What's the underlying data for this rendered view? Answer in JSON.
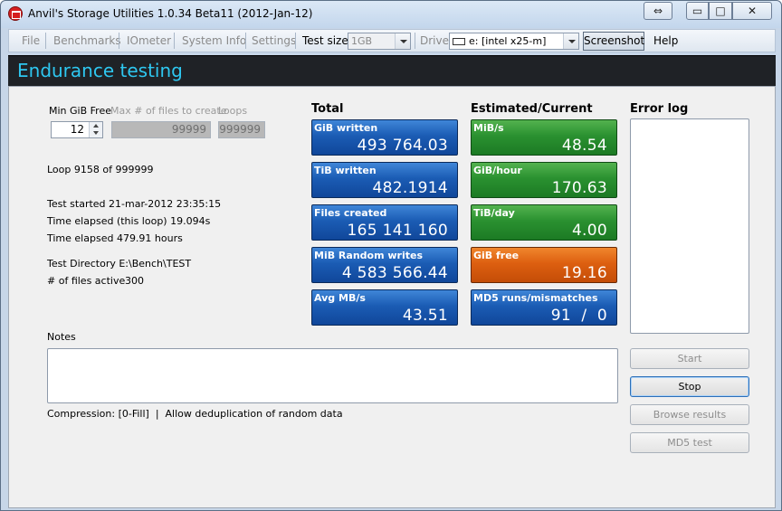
{
  "window": {
    "title": "Anvil's Storage Utilities 1.0.34 Beta11 (2012-Jan-12)",
    "resize_glyph": "⇔",
    "min_glyph": "▭",
    "max_glyph": "□",
    "close_glyph": "✕"
  },
  "menu": {
    "file": "File",
    "benchmarks": "Benchmarks",
    "iometer": "IOmeter",
    "system_info": "System Info",
    "settings": "Settings",
    "test_size_label": "Test size",
    "test_size_value": "1GB",
    "drive_label": "Drive",
    "drive_value": "e: [intel x25-m]",
    "screenshot": "Screenshot",
    "help": "Help"
  },
  "banner": {
    "title": "Endurance testing"
  },
  "params": {
    "min_gib_label": "Min GiB Free",
    "min_gib_value": "12",
    "max_files_label": "Max # of files to create",
    "max_files_value": "99999",
    "loops_label": "Loops",
    "loops_value": "999999"
  },
  "status": {
    "loop": "Loop 9158 of 999999",
    "started": "Test started 21-mar-2012 23:35:15",
    "elapsed_loop": "Time elapsed (this loop) 19.094s",
    "elapsed": "Time elapsed 479.91 hours",
    "directory": "Test Directory E:\\Bench\\TEST",
    "files_active_label": "# of files active",
    "files_active_value": "300"
  },
  "totals": {
    "heading": "Total",
    "tiles": [
      {
        "label": "GiB written",
        "value": "493 764.03"
      },
      {
        "label": "TiB written",
        "value": "482.1914"
      },
      {
        "label": "Files created",
        "value": "165 141 160"
      },
      {
        "label": "MiB Random writes",
        "value": "4 583 566.44"
      },
      {
        "label": "Avg MB/s",
        "value": "43.51"
      }
    ]
  },
  "current": {
    "heading": "Estimated/Current",
    "tiles": [
      {
        "label": "MiB/s",
        "value": "48.54"
      },
      {
        "label": "GiB/hour",
        "value": "170.63"
      },
      {
        "label": "TiB/day",
        "value": "4.00"
      },
      {
        "label": "GiB free",
        "value": "19.16"
      },
      {
        "label": "MD5 runs/mismatches",
        "value": "91  /  0"
      }
    ]
  },
  "errors": {
    "heading": "Error log"
  },
  "notes": {
    "label": "Notes",
    "compression": "Compression: [0-Fill]  |  Allow deduplication of random data"
  },
  "buttons": {
    "start": "Start",
    "stop": "Stop",
    "browse": "Browse results",
    "md5": "MD5 test"
  },
  "colors": {
    "tile_blue": "#1b5cb4",
    "tile_green": "#2a9130",
    "tile_orange": "#dd5f10",
    "banner_text": "#2ec7f0"
  }
}
